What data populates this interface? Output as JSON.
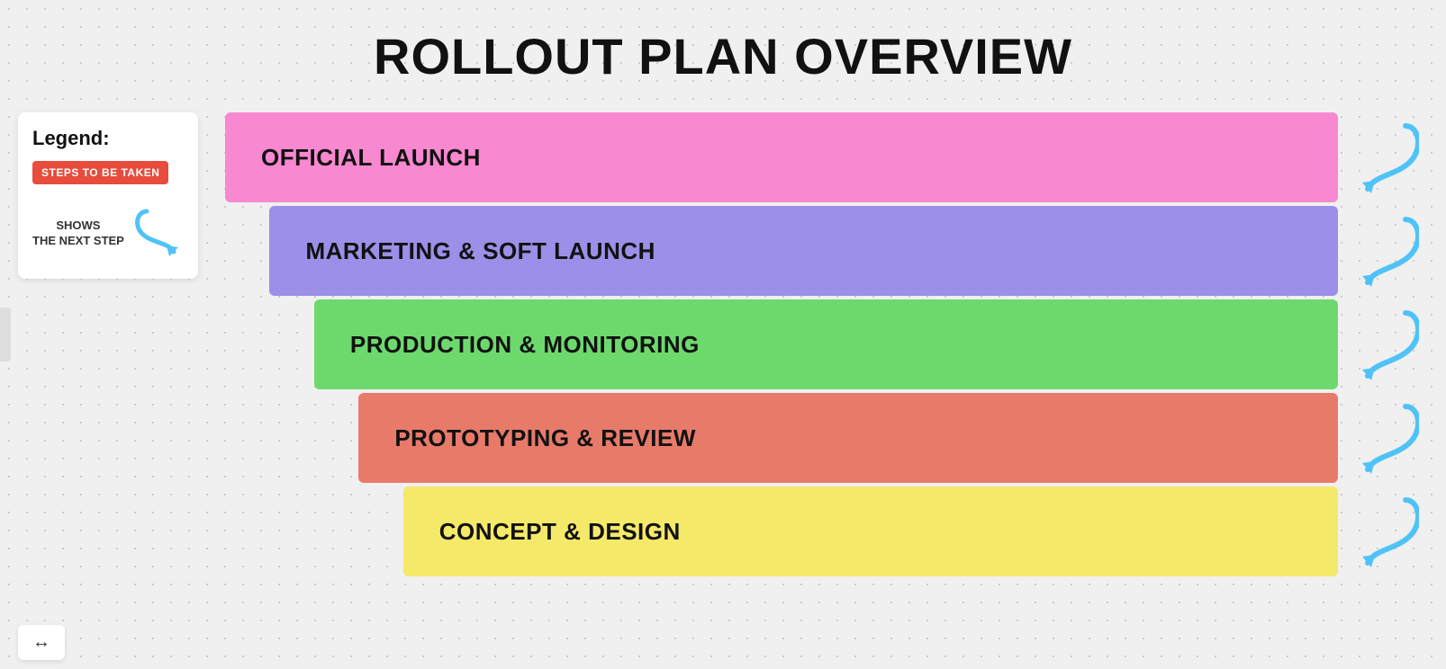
{
  "title": "ROLLOUT PLAN OVERVIEW",
  "legend": {
    "title": "Legend:",
    "badge_label": "STEPS TO BE TAKEN",
    "arrow_text_line1": "SHOWS",
    "arrow_text_line2": "THE NEXT STEP"
  },
  "steps": [
    {
      "label": "OFFICIAL LAUNCH",
      "color": "#f888d0",
      "width_pct": 100,
      "margin_pct": 0
    },
    {
      "label": "MARKETING & SOFT LAUNCH",
      "color": "#9b8fe8",
      "width_pct": 96,
      "margin_pct": 4
    },
    {
      "label": "PRODUCTION & MONITORING",
      "color": "#6dd96d",
      "width_pct": 92,
      "margin_pct": 8
    },
    {
      "label": "PROTOTYPING & REVIEW",
      "color": "#e87a6a",
      "width_pct": 88,
      "margin_pct": 12
    },
    {
      "label": "CONCEPT & DESIGN",
      "color": "#f5e96a",
      "width_pct": 84,
      "margin_pct": 16
    }
  ],
  "arrow_color": "#4fc3f7",
  "bottom_handle_icon": "↔"
}
